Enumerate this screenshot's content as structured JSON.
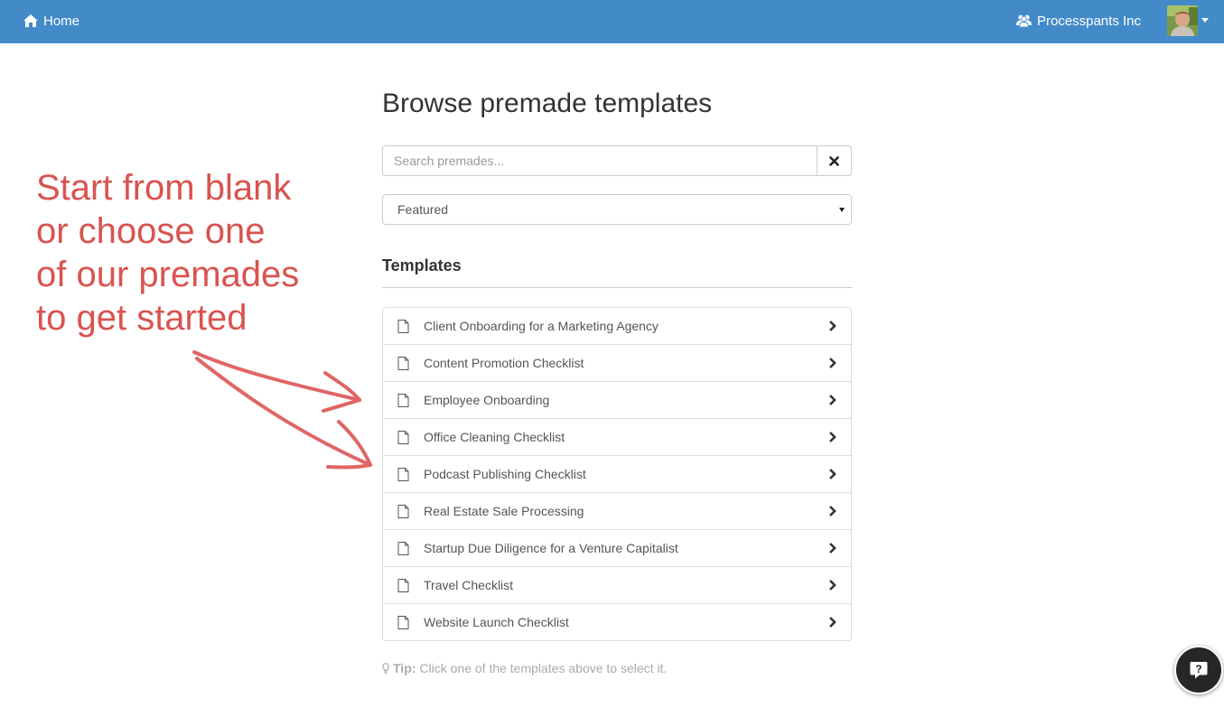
{
  "navbar": {
    "home_label": "Home",
    "org_label": "Processpants Inc",
    "background": "#438ac9"
  },
  "annotation": {
    "lines": [
      "Start from blank",
      "or choose one",
      "of our premades",
      "to get started"
    ],
    "color": "#d9534f"
  },
  "main": {
    "title": "Browse premade templates",
    "search": {
      "placeholder": "Search premades...",
      "value": ""
    },
    "filter": {
      "selected": "Featured"
    },
    "section_heading": "Templates",
    "templates": [
      {
        "label": "Client Onboarding for a Marketing Agency"
      },
      {
        "label": "Content Promotion Checklist"
      },
      {
        "label": "Employee Onboarding"
      },
      {
        "label": "Office Cleaning Checklist"
      },
      {
        "label": "Podcast Publishing Checklist"
      },
      {
        "label": "Real Estate Sale Processing"
      },
      {
        "label": "Startup Due Diligence for a Venture Capitalist"
      },
      {
        "label": "Travel Checklist"
      },
      {
        "label": "Website Launch Checklist"
      }
    ],
    "tip": {
      "label": "Tip:",
      "text": "Click one of the templates above to select it."
    }
  },
  "icons": {
    "home": "home-icon",
    "org": "users-icon",
    "clear": "close-icon",
    "template": "file-icon",
    "open": "chevron-right-icon",
    "tip": "lightbulb-icon",
    "help": "question-bubble-icon"
  }
}
